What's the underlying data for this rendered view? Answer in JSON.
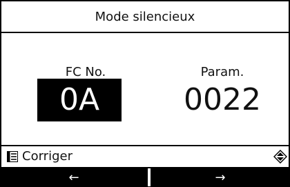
{
  "title": "Mode silencieux",
  "fc": {
    "label": "FC No.",
    "value": "0A"
  },
  "param": {
    "label": "Param.",
    "value": "0022"
  },
  "status": {
    "action_label": "Corriger",
    "menu_icon": "menu-icon",
    "scroll_icon": "up-down-icon"
  },
  "buttons": {
    "left": "←",
    "right": "→"
  }
}
